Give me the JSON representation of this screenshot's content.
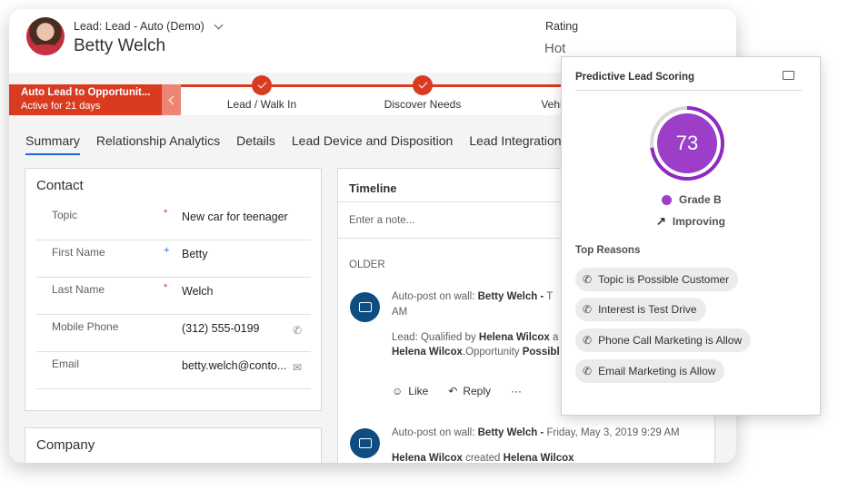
{
  "header": {
    "form_name": "Lead: Lead - Auto (Demo)",
    "lead_name": "Betty Welch",
    "rating_label": "Rating",
    "rating_value": "Hot"
  },
  "bpf": {
    "active_title": "Auto Lead to Opportunit...",
    "active_duration": "Active for 21 days",
    "stages": [
      "Lead / Walk In",
      "Discover Needs",
      "Vehi"
    ]
  },
  "tabs": [
    "Summary",
    "Relationship Analytics",
    "Details",
    "Lead Device and Disposition",
    "Lead Integration"
  ],
  "contact": {
    "title": "Contact",
    "fields": [
      {
        "label": "Topic",
        "required": "*",
        "value": "New car for teenager",
        "icon": ""
      },
      {
        "label": "First Name",
        "required": "+",
        "value": "Betty",
        "icon": ""
      },
      {
        "label": "Last Name",
        "required": "*",
        "value": "Welch",
        "icon": ""
      },
      {
        "label": "Mobile Phone",
        "required": "",
        "value": "(312) 555-0199",
        "icon": "phone-icon"
      },
      {
        "label": "Email",
        "required": "",
        "value": "betty.welch@conto...",
        "icon": "email-icon"
      }
    ]
  },
  "company": {
    "title": "Company"
  },
  "timeline": {
    "title": "Timeline",
    "note_placeholder": "Enter a note...",
    "older_label": "OLDER",
    "post1": {
      "prefix": "Auto-post on wall:",
      "author": "Betty Welch -",
      "date_fragment": "T",
      "am": "AM",
      "line1_text": "Lead: Qualified by",
      "line1_name": "Helena Wilcox",
      "line1_tail": "a",
      "line2_name": "Helena Wilcox",
      "line2_text": ".Opportunity",
      "line2_tail": "Possibl"
    },
    "actions": {
      "like": "Like",
      "reply": "Reply",
      "more": "···"
    },
    "post2": {
      "prefix": "Auto-post on wall:",
      "author": "Betty Welch -",
      "date": "Friday, May 3, 2019 9:29 AM",
      "line1_name": "Helena Wilcox",
      "line1_text": "created",
      "line1_name2": "Helena Wilcox"
    }
  },
  "scoring": {
    "title": "Predictive Lead Scoring",
    "score": "73",
    "score_fraction": 0.73,
    "grade": "Grade B",
    "trend": "Improving",
    "reasons_title": "Top Reasons",
    "reasons": [
      "Topic is Possible Customer",
      "Interest is Test Drive",
      "Phone Call Marketing is Allow",
      "Email Marketing is Allow"
    ]
  },
  "colors": {
    "accent": "#d83b20",
    "score_purple": "#9c3ec8",
    "timeline_avatar": "#0f4c81",
    "tab_underline": "#2266e3"
  }
}
